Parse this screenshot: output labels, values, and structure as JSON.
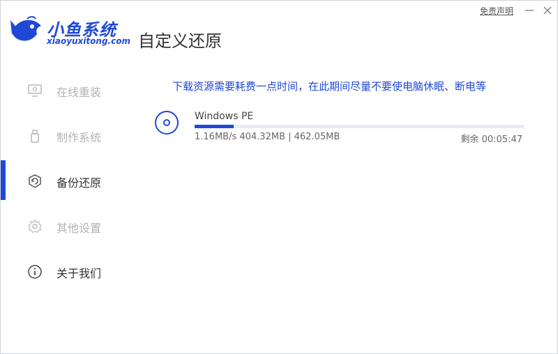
{
  "app": {
    "logo_title": "小鱼系统",
    "logo_subtitle": "xiaoyuxitong.com",
    "brand_color": "#1f49d4"
  },
  "header": {
    "page_title": "自定义还原",
    "disclaimer_label": "免责声明",
    "minimize_icon": "minimize-icon",
    "close_icon": "close-icon"
  },
  "sidebar": {
    "items": [
      {
        "label": "在线重装",
        "icon": "monitor-icon",
        "active": false
      },
      {
        "label": "制作系统",
        "icon": "usb-icon",
        "active": false
      },
      {
        "label": "备份还原",
        "icon": "backup-icon",
        "active": true
      },
      {
        "label": "其他设置",
        "icon": "gear-icon",
        "active": false
      },
      {
        "label": "关于我们",
        "icon": "info-icon",
        "active": false
      }
    ]
  },
  "main": {
    "notice": "下载资源需要耗费一点时间，在此期间尽量不要使电脑休眠、断电等",
    "download": {
      "name": "Windows PE",
      "progress_percent": 11.8,
      "stats": "1.16MB/s 404.32MB | 462.05MB",
      "remaining": "剩余 00:05:47"
    }
  }
}
